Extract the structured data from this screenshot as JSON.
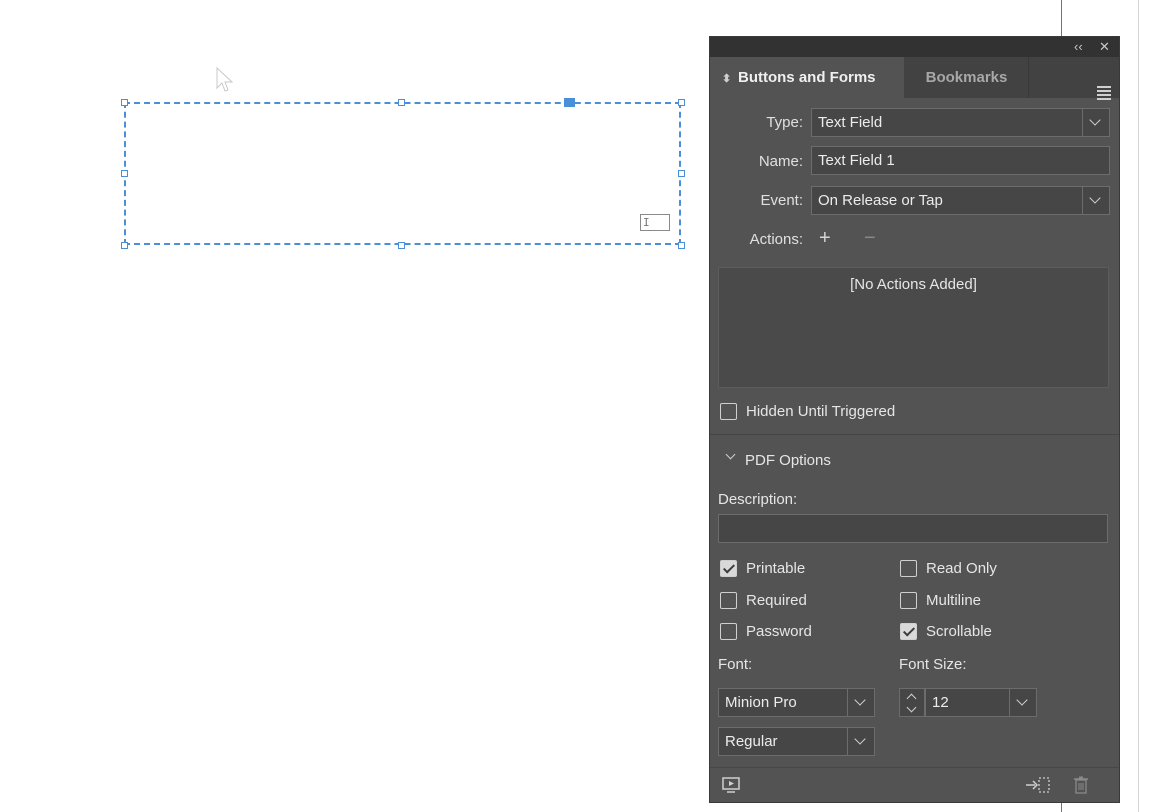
{
  "window": {
    "collapse_label": "‹‹",
    "close_label": "✕"
  },
  "canvas": {
    "field_indicator_label": "I"
  },
  "panel": {
    "tabs": [
      {
        "label": "Buttons and Forms",
        "active": true
      },
      {
        "label": "Bookmarks",
        "active": false
      }
    ],
    "type": {
      "label": "Type:",
      "value": "Text Field"
    },
    "name": {
      "label": "Name:",
      "value": "Text Field 1"
    },
    "event": {
      "label": "Event:",
      "value": "On Release or Tap"
    },
    "actions": {
      "label": "Actions:",
      "add_label": "+",
      "remove_label": "−",
      "empty_text": "[No Actions Added]"
    },
    "hidden_until_triggered": {
      "label": "Hidden Until Triggered",
      "checked": false
    },
    "pdf_options": {
      "title": "PDF Options",
      "description_label": "Description:",
      "description_value": "",
      "checkboxes": [
        {
          "label": "Printable",
          "checked": true
        },
        {
          "label": "Read Only",
          "checked": false
        },
        {
          "label": "Required",
          "checked": false
        },
        {
          "label": "Multiline",
          "checked": false
        },
        {
          "label": "Password",
          "checked": false
        },
        {
          "label": "Scrollable",
          "checked": true
        }
      ],
      "font_label": "Font:",
      "font_family": "Minion Pro",
      "font_style": "Regular",
      "font_size_label": "Font Size:",
      "font_size": "12"
    }
  },
  "colors": {
    "panel_bg": "#535353",
    "accent_selection": "#4a90d9",
    "margin_guide": "#b04ab0"
  }
}
